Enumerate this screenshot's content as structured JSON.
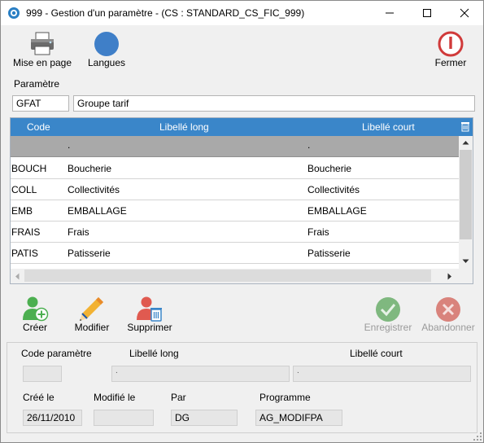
{
  "window": {
    "title": "999 - Gestion d'un paramètre - (CS : STANDARD_CS_FIC_999)",
    "minimize_label": "—",
    "maximize_label": "☐",
    "close_label": "✕"
  },
  "toolbar": {
    "print_label": "Mise en page",
    "languages_label": "Langues",
    "close_label": "Fermer"
  },
  "parametre": {
    "section_label": "Paramètre",
    "code": "GFAT",
    "libelle": "Groupe tarif"
  },
  "grid": {
    "columns": [
      "Code",
      "Libellé long",
      "Libellé court"
    ],
    "selected_row": {
      "code": "",
      "long": ".",
      "court": "."
    },
    "rows": [
      {
        "code": "BOUCH",
        "long": "Boucherie",
        "court": "Boucherie"
      },
      {
        "code": "COLL",
        "long": "Collectivités",
        "court": "Collectivités"
      },
      {
        "code": "EMB",
        "long": "EMBALLAGE",
        "court": "EMBALLAGE"
      },
      {
        "code": "FRAIS",
        "long": "Frais",
        "court": "Frais"
      },
      {
        "code": "PATIS",
        "long": "Patisserie",
        "court": "Patisserie"
      }
    ]
  },
  "actions": {
    "create_label": "Créer",
    "modify_label": "Modifier",
    "delete_label": "Supprimer",
    "save_label": "Enregistrer",
    "cancel_label": "Abandonner"
  },
  "detail": {
    "code_label": "Code paramètre",
    "long_label": "Libellé long",
    "court_label": "Libellé court",
    "code_value": "",
    "long_value": ".",
    "court_value": ".",
    "created_label": "Créé le",
    "modified_label": "Modifié le",
    "by_label": "Par",
    "program_label": "Programme",
    "created_value": "26/11/2010",
    "modified_value": "",
    "by_value": "DG",
    "program_value": "AG_MODIFPA"
  },
  "colors": {
    "header_blue": "#3a86c9",
    "create_green": "#4caf50",
    "delete_red": "#e05a50",
    "save_disabled_green": "#7fb87f",
    "cancel_disabled_red": "#d9837c",
    "close_red": "#d03a3a",
    "languages_blue": "#3f7fc8"
  }
}
